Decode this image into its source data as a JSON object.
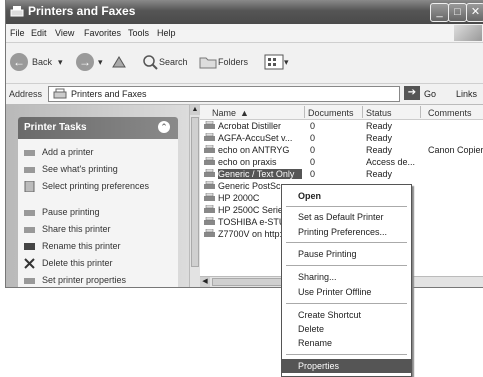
{
  "window": {
    "title": "Printers and Faxes"
  },
  "menu": [
    "File",
    "Edit",
    "View",
    "Favorites",
    "Tools",
    "Help"
  ],
  "toolbar": {
    "back": "Back",
    "search": "Search",
    "folders": "Folders"
  },
  "address": {
    "label": "Address",
    "value": "Printers and Faxes",
    "go": "Go",
    "links": "Links"
  },
  "tasks": {
    "title": "Printer Tasks",
    "items": [
      "Add a printer",
      "See what's printing",
      "Select printing preferences",
      "Pause printing",
      "Share this printer",
      "Rename this printer",
      "Delete this printer",
      "Set printer properties"
    ]
  },
  "columns": [
    "Name",
    "Documents",
    "Status",
    "Comments"
  ],
  "printers": [
    {
      "name": "Acrobat Distiller",
      "docs": "0",
      "status": "Ready",
      "comments": ""
    },
    {
      "name": "AGFA-AccuSet v...",
      "docs": "0",
      "status": "Ready",
      "comments": ""
    },
    {
      "name": "echo on ANTRYG",
      "docs": "0",
      "status": "Ready",
      "comments": "Canon Copier"
    },
    {
      "name": "echo on praxis",
      "docs": "0",
      "status": "Access de...",
      "comments": ""
    },
    {
      "name": "Generic / Text Only",
      "docs": "0",
      "status": "Ready",
      "comments": ""
    },
    {
      "name": "Generic PostScript",
      "docs": "",
      "status": "",
      "comments": ""
    },
    {
      "name": "HP 2000C",
      "docs": "",
      "status": "",
      "comments": ""
    },
    {
      "name": "HP 2500C Series",
      "docs": "",
      "status": "",
      "comments": ""
    },
    {
      "name": "TOSHIBA e-STUDIO",
      "docs": "",
      "status": "",
      "comments": ""
    },
    {
      "name": "Z7700V on http:",
      "docs": "",
      "status": "",
      "comments": ""
    }
  ],
  "context_menu": {
    "open": "Open",
    "set_default": "Set as Default Printer",
    "preferences": "Printing Preferences...",
    "pause": "Pause Printing",
    "sharing": "Sharing...",
    "offline": "Use Printer Offline",
    "shortcut": "Create Shortcut",
    "delete": "Delete",
    "rename": "Rename",
    "properties": "Properties"
  }
}
